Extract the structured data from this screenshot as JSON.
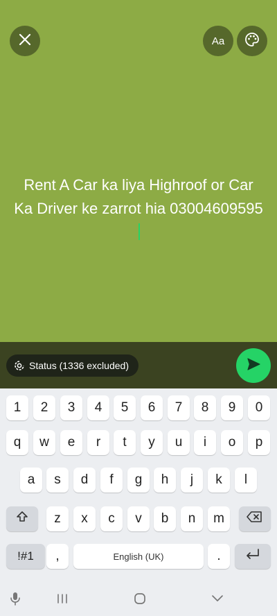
{
  "canvas": {
    "background_color": "#8dab45",
    "text": "Rent A Car ka liya Highroof or Car Ka Driver ke zarrot hia 03004609595"
  },
  "top_controls": {
    "close_icon": "close-icon",
    "font_label": "Aa",
    "palette_icon": "palette-icon"
  },
  "footer": {
    "audience_label": "Status (1336 excluded)",
    "send_icon": "send-icon",
    "accent_color": "#25d366"
  },
  "keyboard": {
    "rows": [
      [
        "1",
        "2",
        "3",
        "4",
        "5",
        "6",
        "7",
        "8",
        "9",
        "0"
      ],
      [
        "q",
        "w",
        "e",
        "r",
        "t",
        "y",
        "u",
        "i",
        "o",
        "p"
      ],
      [
        "a",
        "s",
        "d",
        "f",
        "g",
        "h",
        "j",
        "k",
        "l"
      ],
      [
        "z",
        "x",
        "c",
        "v",
        "b",
        "n",
        "m"
      ]
    ],
    "symbols_label": "!#1",
    "comma_label": ",",
    "space_label": "English (UK)",
    "period_label": "."
  }
}
